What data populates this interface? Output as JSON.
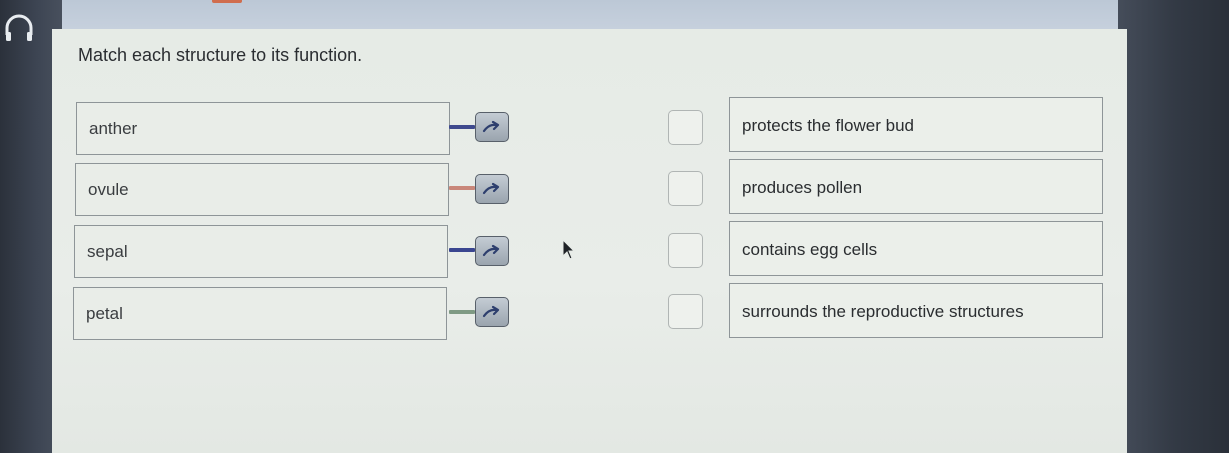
{
  "instruction": "Match each structure to its function.",
  "terms": [
    {
      "label": "anther",
      "connector_color": "#3f4a8e"
    },
    {
      "label": "ovule",
      "connector_color": "#c9877a"
    },
    {
      "label": "sepal",
      "connector_color": "#3a4690"
    },
    {
      "label": "petal",
      "connector_color": "#7f9a84"
    }
  ],
  "answers": [
    {
      "label": "protects the flower bud"
    },
    {
      "label": "produces pollen"
    },
    {
      "label": "contains egg cells"
    },
    {
      "label": "surrounds the reproductive structures"
    }
  ],
  "icons": {
    "audio": "headphone-icon",
    "match_arrow": "arrow-right-icon",
    "pointer": "mouse-cursor-icon"
  },
  "colors": {
    "content_bg": "#e6ebe6",
    "top_bar": "#c6d0dd",
    "button_bg": "#aab3bc",
    "arrow": "#2e3f6e"
  }
}
